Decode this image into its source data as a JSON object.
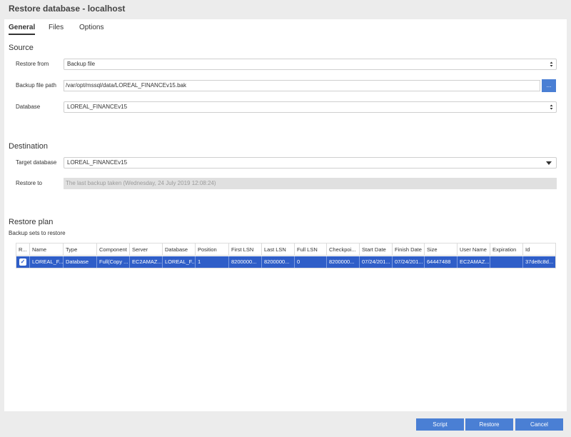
{
  "window": {
    "title": "Restore database - localhost"
  },
  "tabs": [
    {
      "label": "General",
      "active": true
    },
    {
      "label": "Files",
      "active": false
    },
    {
      "label": "Options",
      "active": false
    }
  ],
  "source": {
    "title": "Source",
    "restore_from": {
      "label": "Restore from",
      "value": "Backup file"
    },
    "backup_file_path": {
      "label": "Backup file path",
      "value": "/var/opt/mssql/data/LOREAL_FINANCEv15.bak",
      "browse_label": "..."
    },
    "database": {
      "label": "Database",
      "value": "LOREAL_FINANCEv15"
    }
  },
  "destination": {
    "title": "Destination",
    "target_database": {
      "label": "Target database",
      "value": "LOREAL_FINANCEv15"
    },
    "restore_to": {
      "label": "Restore to",
      "value": "The last backup taken (Wednesday, 24 July 2019 12:08:24)"
    }
  },
  "restore_plan": {
    "title": "Restore plan",
    "subtitle": "Backup sets to restore",
    "columns": [
      "R...",
      "Name",
      "Type",
      "Component",
      "Server",
      "Database",
      "Position",
      "First LSN",
      "Last LSN",
      "Full LSN",
      "Checkpoi...",
      "Start Date",
      "Finish Date",
      "Size",
      "User Name",
      "Expiration",
      "Id"
    ],
    "rows": [
      {
        "checked": true,
        "cells": [
          "LOREAL_F...",
          "Database",
          "Full(Copy ...",
          "EC2AMAZ...",
          "LOREAL_F...",
          "1",
          "8200000...",
          "8200000...",
          "0",
          "8200000...",
          "07/24/201...",
          "07/24/201...",
          "64447488",
          "EC2AMAZ...",
          "",
          "37de8c8d..."
        ]
      }
    ]
  },
  "footer": {
    "script_label": "Script",
    "restore_label": "Restore",
    "cancel_label": "Cancel"
  },
  "colors": {
    "accent": "#4a7fd4",
    "selection": "#2f5ec8"
  }
}
